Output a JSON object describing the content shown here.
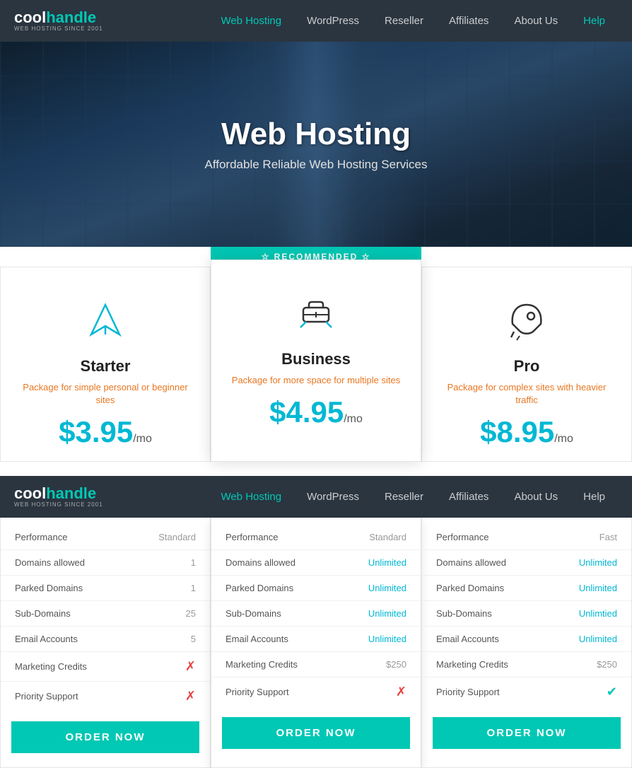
{
  "nav": {
    "logo_cool": "cool",
    "logo_handle": "handle",
    "logo_sub": "Web Hosting Since 2001",
    "links": [
      {
        "label": "Web Hosting",
        "active": true
      },
      {
        "label": "WordPress",
        "active": false
      },
      {
        "label": "Reseller",
        "active": false
      },
      {
        "label": "Affiliates",
        "active": false
      },
      {
        "label": "About Us",
        "active": false
      },
      {
        "label": "Help",
        "active": false,
        "accent": true
      }
    ]
  },
  "hero": {
    "title": "Web Hosting",
    "subtitle": "Affordable Reliable Web Hosting Services"
  },
  "recommended_badge": "☆ RECOMMENDED ☆",
  "plans": [
    {
      "id": "starter",
      "name": "Starter",
      "desc": "Package for simple personal or beginner sites",
      "price": "$3.95",
      "per": "/mo",
      "icon": "plane"
    },
    {
      "id": "business",
      "name": "Business",
      "desc": "Package for more space for multiple sites",
      "price": "$4.95",
      "per": "/mo",
      "icon": "ticket",
      "recommended": true
    },
    {
      "id": "pro",
      "name": "Pro",
      "desc": "Package for complex sites with heavier traffic",
      "price": "$8.95",
      "per": "/mo",
      "icon": "rocket"
    }
  ],
  "features": [
    {
      "label": "Performance",
      "starter": {
        "value": "Standard",
        "type": "normal"
      },
      "business": {
        "value": "Standard",
        "type": "normal"
      },
      "pro": {
        "value": "Fast",
        "type": "normal"
      }
    },
    {
      "label": "Domains allowed",
      "starter": {
        "value": "1",
        "type": "normal"
      },
      "business": {
        "value": "Unlimited",
        "type": "blue"
      },
      "pro": {
        "value": "Unlimited",
        "type": "blue"
      }
    },
    {
      "label": "Parked Domains",
      "starter": {
        "value": "1",
        "type": "normal"
      },
      "business": {
        "value": "Unlimited",
        "type": "blue"
      },
      "pro": {
        "value": "Unlimited",
        "type": "blue"
      }
    },
    {
      "label": "Sub-Domains",
      "starter": {
        "value": "25",
        "type": "normal"
      },
      "business": {
        "value": "Unlimited",
        "type": "blue"
      },
      "pro": {
        "value": "Unlimtied",
        "type": "blue"
      }
    },
    {
      "label": "Email Accounts",
      "starter": {
        "value": "5",
        "type": "normal"
      },
      "business": {
        "value": "Unlimited",
        "type": "blue"
      },
      "pro": {
        "value": "Unlimited",
        "type": "blue"
      }
    },
    {
      "label": "Marketing Credits",
      "starter": {
        "value": "✗",
        "type": "cross"
      },
      "business": {
        "value": "$250",
        "type": "normal"
      },
      "pro": {
        "value": "$250",
        "type": "normal"
      }
    },
    {
      "label": "Priority Support",
      "starter": {
        "value": "✗",
        "type": "cross"
      },
      "business": {
        "value": "✗",
        "type": "cross"
      },
      "pro": {
        "value": "✔",
        "type": "check"
      }
    }
  ],
  "order_btn_label": "ORDER NOW"
}
